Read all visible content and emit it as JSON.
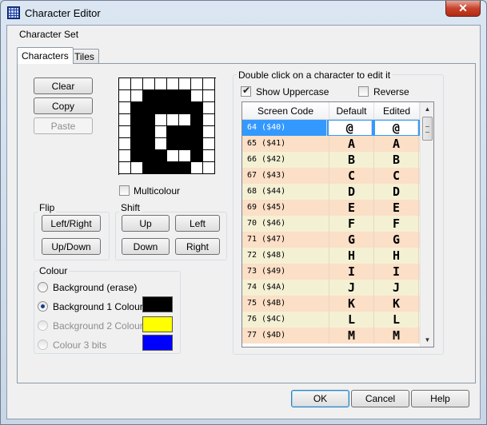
{
  "window": {
    "title": "Character Editor",
    "close_glyph": "✕"
  },
  "heading": "Character Set",
  "tabs": [
    {
      "label": "Characters"
    },
    {
      "label": "Tiles"
    }
  ],
  "edit_buttons": {
    "clear": "Clear",
    "copy": "Copy",
    "paste": "Paste"
  },
  "multicolour_label": "Multicolour",
  "multicolour_checked": false,
  "glyph_grid": [
    [
      0,
      0,
      0,
      0,
      0,
      0,
      0,
      0
    ],
    [
      0,
      0,
      1,
      1,
      1,
      1,
      0,
      0
    ],
    [
      0,
      1,
      1,
      1,
      1,
      1,
      1,
      0
    ],
    [
      0,
      1,
      1,
      0,
      0,
      0,
      1,
      0
    ],
    [
      0,
      1,
      1,
      0,
      1,
      1,
      1,
      0
    ],
    [
      0,
      1,
      1,
      0,
      1,
      1,
      1,
      0
    ],
    [
      0,
      1,
      1,
      1,
      0,
      0,
      1,
      0
    ],
    [
      0,
      0,
      1,
      1,
      1,
      1,
      0,
      0
    ]
  ],
  "flip": {
    "label": "Flip",
    "left_right": "Left/Right",
    "up_down": "Up/Down"
  },
  "shift": {
    "label": "Shift",
    "up": "Up",
    "left": "Left",
    "down": "Down",
    "right": "Right"
  },
  "colour": {
    "label": "Colour",
    "options": [
      {
        "label": "Background (erase)",
        "selected": false,
        "enabled": true,
        "swatch": null
      },
      {
        "label": "Background 1 Colour",
        "selected": true,
        "enabled": true,
        "swatch": "#000000"
      },
      {
        "label": "Background 2 Colour",
        "selected": false,
        "enabled": false,
        "swatch": "#ffff00"
      },
      {
        "label": "Colour 3 bits",
        "selected": false,
        "enabled": false,
        "swatch": "#0000ff"
      }
    ]
  },
  "chars_group": {
    "label": "Double click on a character to edit it",
    "show_uppercase_label": "Show Uppercase",
    "show_uppercase_checked": true,
    "reverse_label": "Reverse",
    "reverse_checked": false
  },
  "char_list": {
    "columns": [
      "Screen Code",
      "Default",
      "Edited"
    ],
    "rows": [
      {
        "code": "64  ($40)",
        "default": "@",
        "edited": "@",
        "selected": true
      },
      {
        "code": "65  ($41)",
        "default": "A",
        "edited": "A"
      },
      {
        "code": "66  ($42)",
        "default": "B",
        "edited": "B"
      },
      {
        "code": "67  ($43)",
        "default": "C",
        "edited": "C"
      },
      {
        "code": "68  ($44)",
        "default": "D",
        "edited": "D"
      },
      {
        "code": "69  ($45)",
        "default": "E",
        "edited": "E"
      },
      {
        "code": "70  ($46)",
        "default": "F",
        "edited": "F"
      },
      {
        "code": "71  ($47)",
        "default": "G",
        "edited": "G"
      },
      {
        "code": "72  ($48)",
        "default": "H",
        "edited": "H"
      },
      {
        "code": "73  ($49)",
        "default": "I",
        "edited": "I"
      },
      {
        "code": "74  ($4A)",
        "default": "J",
        "edited": "J"
      },
      {
        "code": "75  ($4B)",
        "default": "K",
        "edited": "K"
      },
      {
        "code": "76  ($4C)",
        "default": "L",
        "edited": "L"
      },
      {
        "code": "77  ($4D)",
        "default": "M",
        "edited": "M"
      }
    ]
  },
  "footer": {
    "ok": "OK",
    "cancel": "Cancel",
    "help": "Help"
  }
}
